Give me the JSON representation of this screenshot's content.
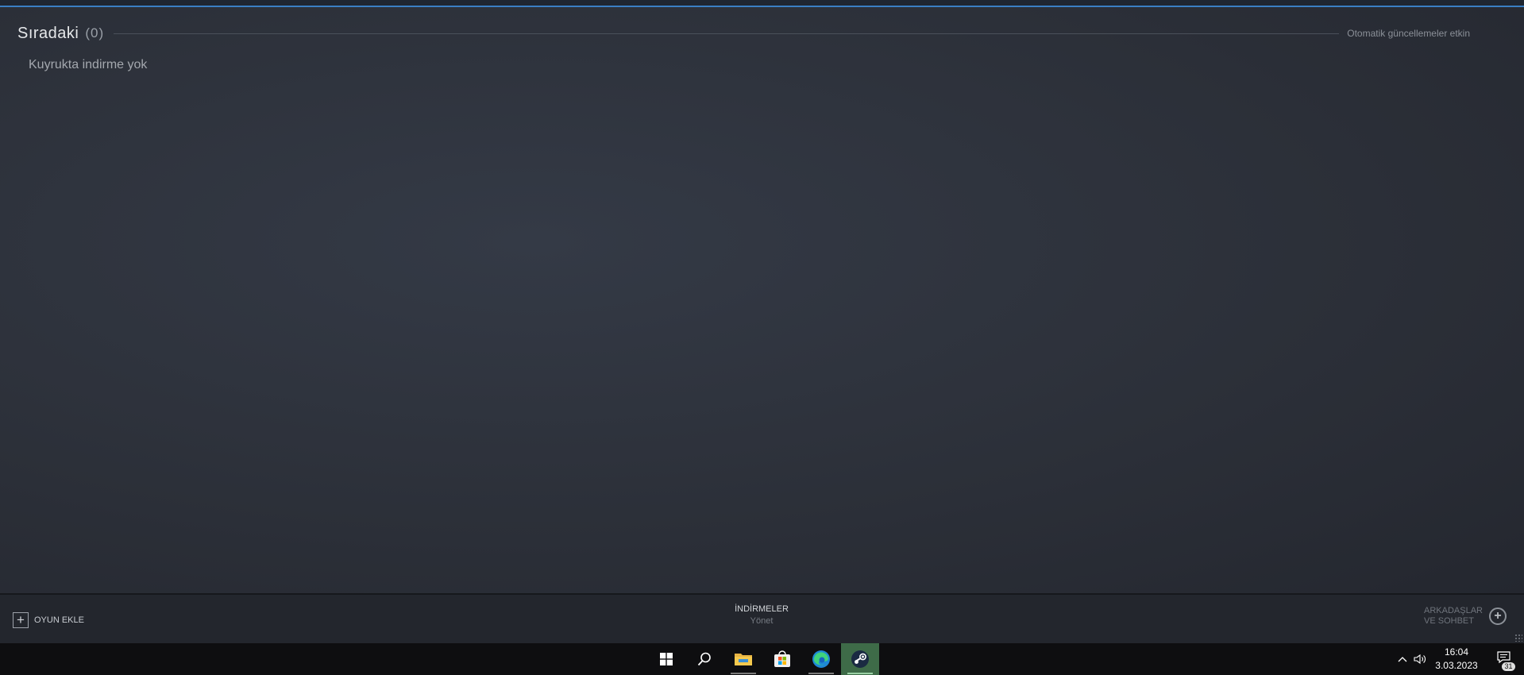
{
  "queue": {
    "title": "Sıradaki",
    "count": "(0)",
    "auto_updates": "Otomatik güncellemeler etkin",
    "empty_message": "Kuyrukta indirme yok"
  },
  "bottom_bar": {
    "add_game_label": "OYUN EKLE",
    "downloads_title": "İNDİRMELER",
    "downloads_sub": "Yönet",
    "friends_line1": "ARKADAŞLAR",
    "friends_line2": "VE SOHBET"
  },
  "taskbar": {
    "time": "16:04",
    "date": "3.03.2023",
    "notification_count": "31",
    "apps": [
      {
        "name": "start",
        "icon": "windows-start-icon"
      },
      {
        "name": "search",
        "icon": "search-icon"
      },
      {
        "name": "file-explorer",
        "icon": "folder-icon"
      },
      {
        "name": "microsoft-store",
        "icon": "store-icon"
      },
      {
        "name": "edge",
        "icon": "edge-browser-icon"
      },
      {
        "name": "steam",
        "icon": "steam-icon",
        "active": true
      }
    ]
  },
  "colors": {
    "accent": "#3a7fc4",
    "background": "#2c3039",
    "active_taskbar": "#3e6b48"
  }
}
